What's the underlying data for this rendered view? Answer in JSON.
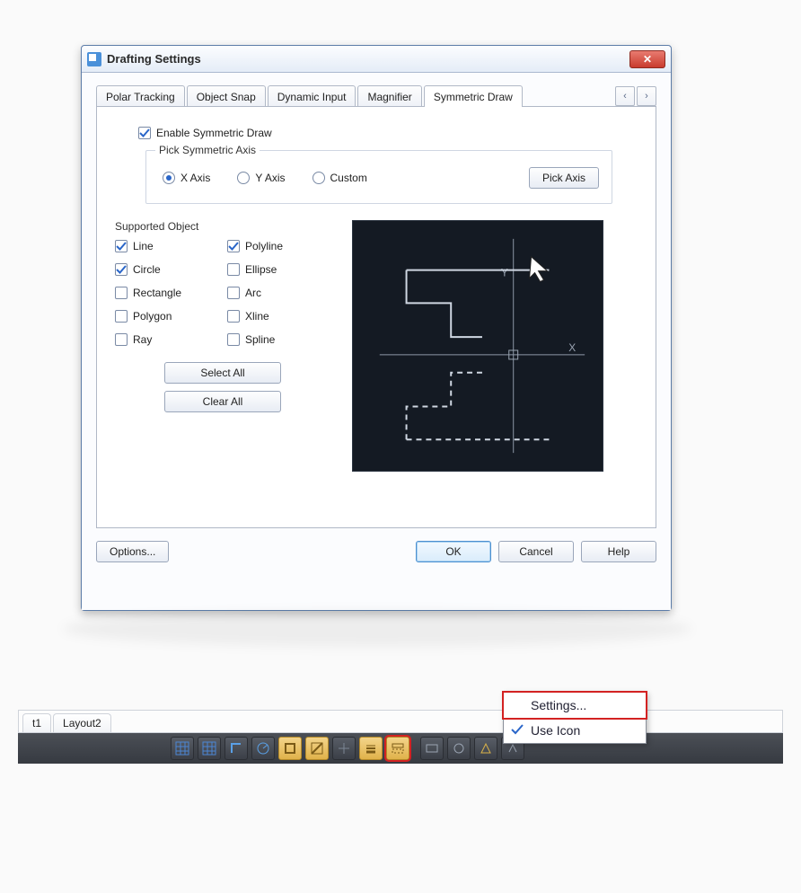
{
  "dialog": {
    "title": "Drafting Settings",
    "tabs": {
      "polar": "Polar Tracking",
      "osnap": "Object Snap",
      "dyninput": "Dynamic Input",
      "magnifier": "Magnifier",
      "symdraw": "Symmetric Draw"
    },
    "enable_label": "Enable Symmetric Draw",
    "axis_group": {
      "title": "Pick Symmetric Axis",
      "x": "X Axis",
      "y": "Y Axis",
      "custom": "Custom",
      "pick_button": "Pick Axis"
    },
    "supported": {
      "title": "Supported Object",
      "line": "Line",
      "polyline": "Polyline",
      "circle": "Circle",
      "ellipse": "Ellipse",
      "rectangle": "Rectangle",
      "arc": "Arc",
      "polygon": "Polygon",
      "xline": "Xline",
      "ray": "Ray",
      "spline": "Spline",
      "select_all": "Select All",
      "clear_all": "Clear All"
    },
    "options_button": "Options...",
    "ok": "OK",
    "cancel": "Cancel",
    "help": "Help"
  },
  "bottom": {
    "tab1": "t1",
    "tab2": "Layout2"
  },
  "ctx": {
    "settings": "Settings...",
    "useicon": "Use Icon"
  }
}
